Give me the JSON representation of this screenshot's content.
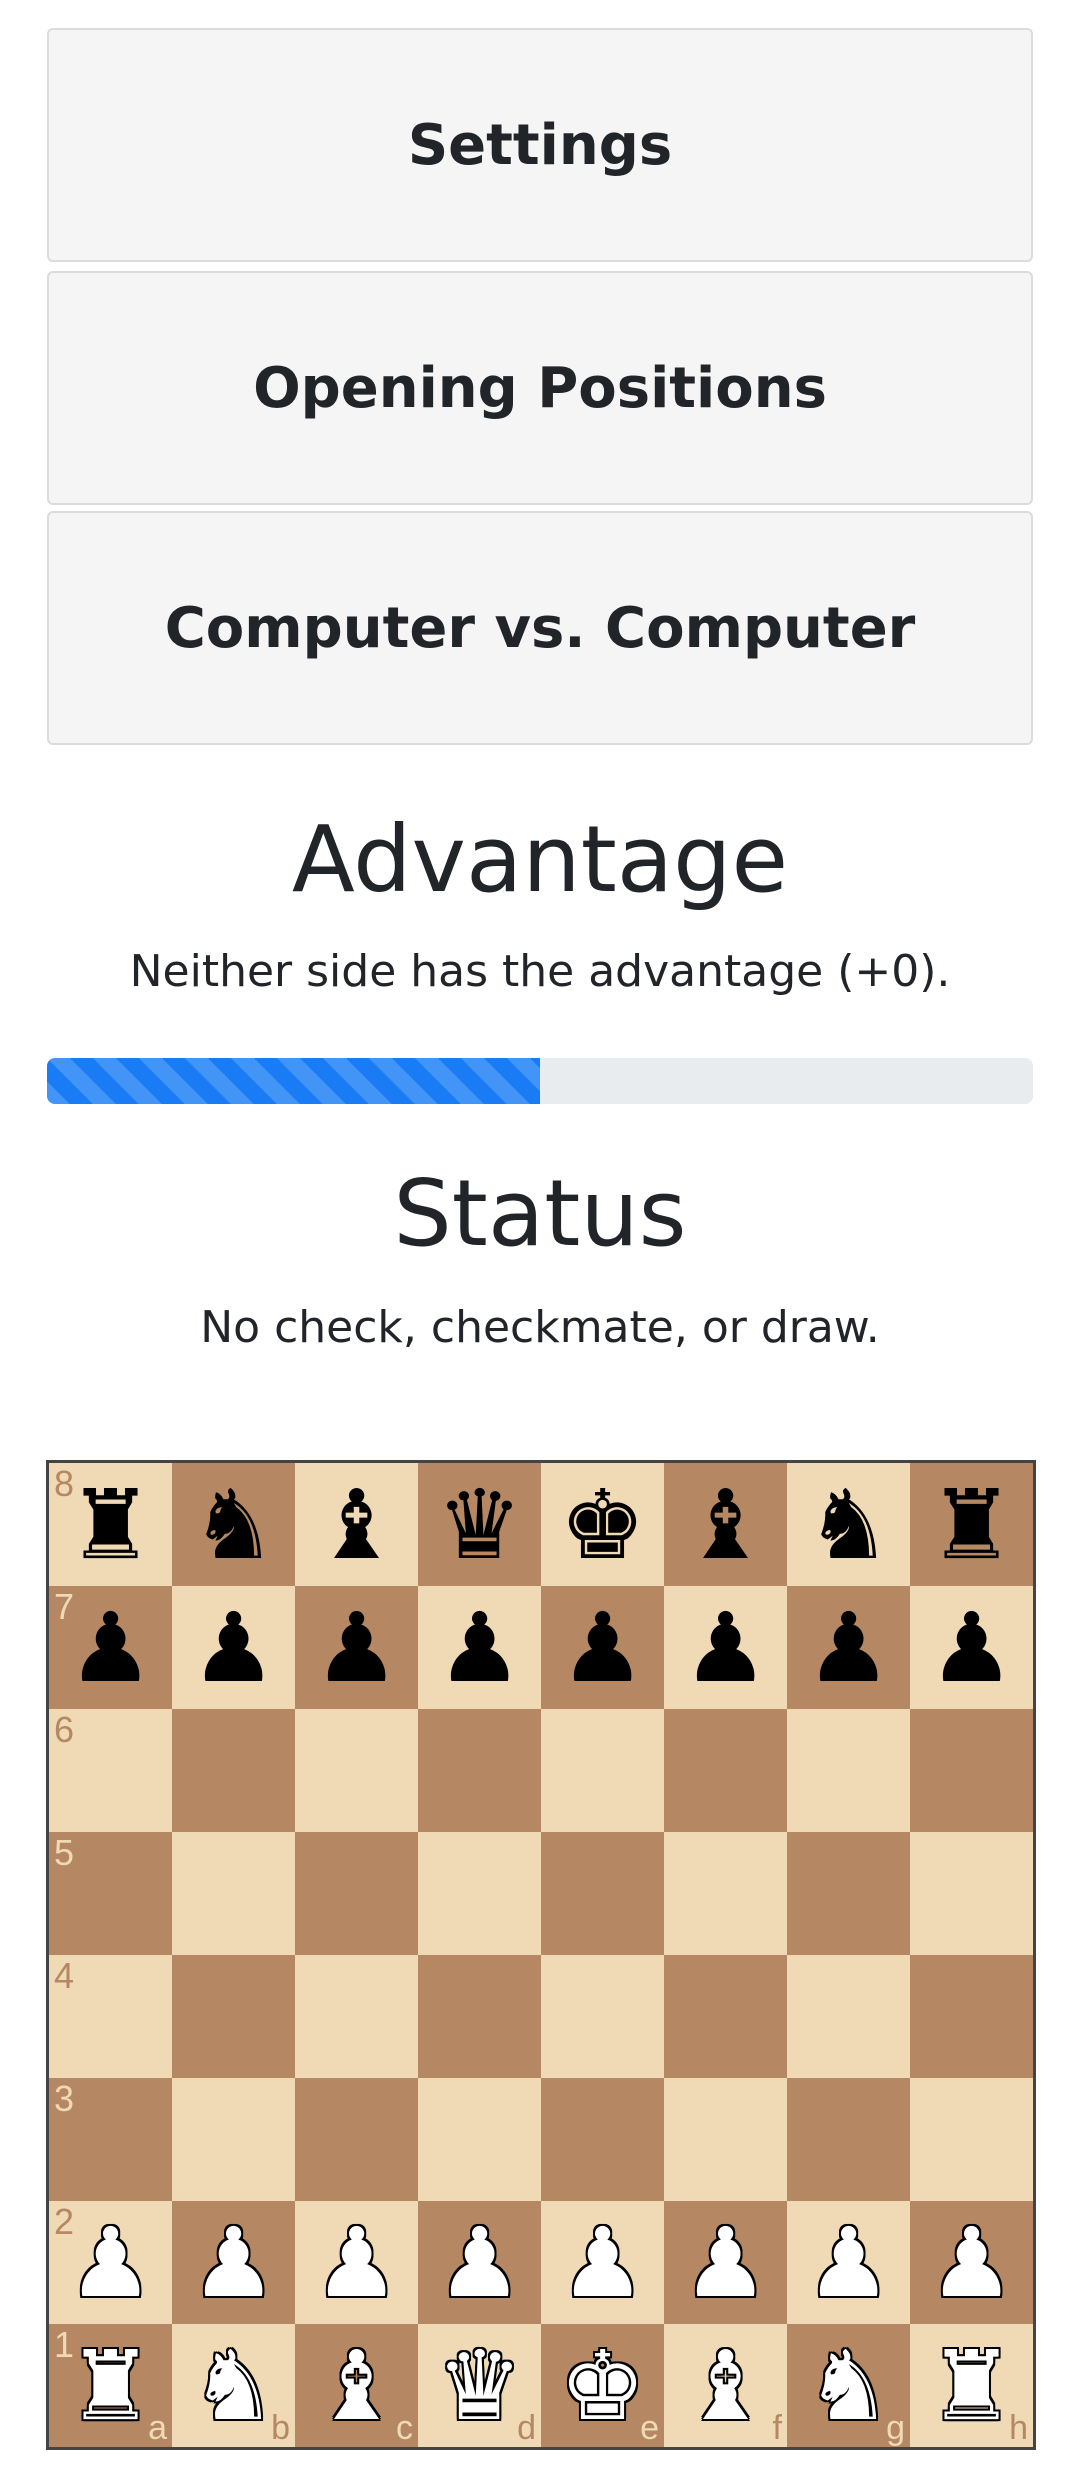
{
  "buttons": {
    "settings": "Settings",
    "opening_positions": "Opening Positions",
    "computer_vs_computer": "Computer vs. Computer"
  },
  "advantage": {
    "title": "Advantage",
    "text": "Neither side has the advantage (+0).",
    "progress_percent": 50,
    "bar_color": "#1a7cf5"
  },
  "status": {
    "title": "Status",
    "text": "No check, checkmate, or draw."
  },
  "board": {
    "light_color": "#f0d9b5",
    "dark_color": "#b58863",
    "files": [
      "a",
      "b",
      "c",
      "d",
      "e",
      "f",
      "g",
      "h"
    ],
    "ranks": [
      "8",
      "7",
      "6",
      "5",
      "4",
      "3",
      "2",
      "1"
    ],
    "position": [
      [
        "br",
        "bn",
        "bb",
        "bq",
        "bk",
        "bb",
        "bn",
        "br"
      ],
      [
        "bp",
        "bp",
        "bp",
        "bp",
        "bp",
        "bp",
        "bp",
        "bp"
      ],
      [
        "",
        "",
        "",
        "",
        "",
        "",
        "",
        ""
      ],
      [
        "",
        "",
        "",
        "",
        "",
        "",
        "",
        ""
      ],
      [
        "",
        "",
        "",
        "",
        "",
        "",
        "",
        ""
      ],
      [
        "",
        "",
        "",
        "",
        "",
        "",
        "",
        ""
      ],
      [
        "wp",
        "wp",
        "wp",
        "wp",
        "wp",
        "wp",
        "wp",
        "wp"
      ],
      [
        "wr",
        "wn",
        "wb",
        "wq",
        "wk",
        "wb",
        "wn",
        "wr"
      ]
    ]
  }
}
